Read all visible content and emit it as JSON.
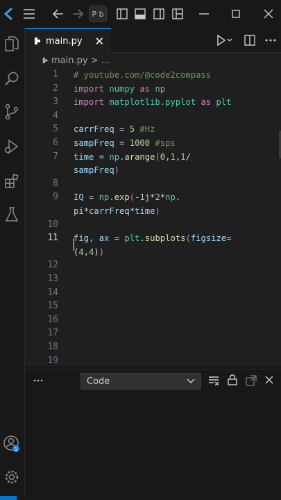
{
  "titlebar": {
    "search_text": "Ρ b"
  },
  "tab": {
    "label": "main.py",
    "close_label": "✕"
  },
  "breadcrumb": {
    "label": "main.py > ..."
  },
  "editor": {
    "line_numbers": [
      "1",
      "2",
      "3",
      "4",
      "5",
      "6",
      "7",
      "",
      "8",
      "9",
      "",
      "10",
      "11",
      "",
      "12",
      "13",
      "14",
      "15",
      "16",
      "17",
      "18",
      "19"
    ],
    "active_line": "11",
    "lines": [
      [
        {
          "t": "# youtube.com/@code2compass",
          "c": "cm"
        }
      ],
      [
        {
          "t": "import ",
          "c": "kw"
        },
        {
          "t": "numpy ",
          "c": "mod"
        },
        {
          "t": "as ",
          "c": "kw"
        },
        {
          "t": "np",
          "c": "mod"
        }
      ],
      [
        {
          "t": "import ",
          "c": "kw"
        },
        {
          "t": "matplotlib.pyplot ",
          "c": "mod"
        },
        {
          "t": "as ",
          "c": "kw"
        },
        {
          "t": "plt",
          "c": "mod"
        }
      ],
      [],
      [
        {
          "t": "carrFreq ",
          "c": "vr"
        },
        {
          "t": "= ",
          "c": "pl"
        },
        {
          "t": "5 ",
          "c": "nm"
        },
        {
          "t": "#Hz",
          "c": "cm"
        }
      ],
      [
        {
          "t": "sampFreq ",
          "c": "vr"
        },
        {
          "t": "= ",
          "c": "pl"
        },
        {
          "t": "1000 ",
          "c": "nm"
        },
        {
          "t": "#sps",
          "c": "cm"
        }
      ],
      [
        {
          "t": "time ",
          "c": "vr"
        },
        {
          "t": "= ",
          "c": "pl"
        },
        {
          "t": "np",
          "c": "mod"
        },
        {
          "t": ".",
          "c": "pl"
        },
        {
          "t": "arange",
          "c": "fn"
        },
        {
          "t": "(",
          "c": "br"
        },
        {
          "t": "0",
          "c": "nm"
        },
        {
          "t": ",",
          "c": "pl"
        },
        {
          "t": "1",
          "c": "nm"
        },
        {
          "t": ",",
          "c": "pl"
        },
        {
          "t": "1",
          "c": "nm"
        },
        {
          "t": "/",
          "c": "pl"
        }
      ],
      [
        {
          "t": "sampFreq",
          "c": "vr"
        },
        {
          "t": ")",
          "c": "br"
        }
      ],
      [],
      [
        {
          "t": "IQ ",
          "c": "vr"
        },
        {
          "t": "= ",
          "c": "pl"
        },
        {
          "t": "np",
          "c": "mod"
        },
        {
          "t": ".",
          "c": "pl"
        },
        {
          "t": "exp",
          "c": "fn"
        },
        {
          "t": "(",
          "c": "br"
        },
        {
          "t": "-1j",
          "c": "nm"
        },
        {
          "t": "*",
          "c": "pl"
        },
        {
          "t": "2",
          "c": "nm"
        },
        {
          "t": "*",
          "c": "pl"
        },
        {
          "t": "np",
          "c": "mod"
        },
        {
          "t": ".",
          "c": "pl"
        }
      ],
      [
        {
          "t": "pi",
          "c": "vr"
        },
        {
          "t": "*",
          "c": "pl"
        },
        {
          "t": "carrFreq",
          "c": "vr"
        },
        {
          "t": "*",
          "c": "pl"
        },
        {
          "t": "time",
          "c": "vr"
        },
        {
          "t": ")",
          "c": "br"
        }
      ],
      [],
      [
        {
          "t": "fig",
          "c": "vr"
        },
        {
          "t": ", ",
          "c": "pl"
        },
        {
          "t": "ax ",
          "c": "vr"
        },
        {
          "t": "= ",
          "c": "pl"
        },
        {
          "t": "plt",
          "c": "mod"
        },
        {
          "t": ".",
          "c": "pl"
        },
        {
          "t": "subplots",
          "c": "fn"
        },
        {
          "t": "(",
          "c": "br"
        },
        {
          "t": "figsize",
          "c": "vr"
        },
        {
          "t": "=",
          "c": "pl"
        }
      ],
      [
        {
          "t": "(",
          "c": "pl"
        },
        {
          "t": "4",
          "c": "nm"
        },
        {
          "t": ",",
          "c": "pl"
        },
        {
          "t": "4",
          "c": "nm"
        },
        {
          "t": ")",
          "c": "pl"
        },
        {
          "t": ")",
          "c": "br"
        }
      ]
    ]
  },
  "panel": {
    "dropdown_value": "Code"
  },
  "colors": {
    "accent": "#0078d4",
    "badge": "#1e88e5",
    "editor_bg": "#1f1f1f",
    "chrome_bg": "#181818"
  },
  "icons": [
    "menu-icon",
    "back-icon",
    "forward-icon",
    "layout-icon",
    "run-icon",
    "split-editor-icon",
    "more-icon",
    "files-icon",
    "search-icon",
    "source-control-icon",
    "run-debug-icon",
    "extensions-icon",
    "testing-icon",
    "accounts-icon",
    "manage-icon",
    "python-file-icon",
    "clear-output-icon",
    "lock-icon",
    "open-in-editor-icon",
    "close-panel-icon"
  ]
}
